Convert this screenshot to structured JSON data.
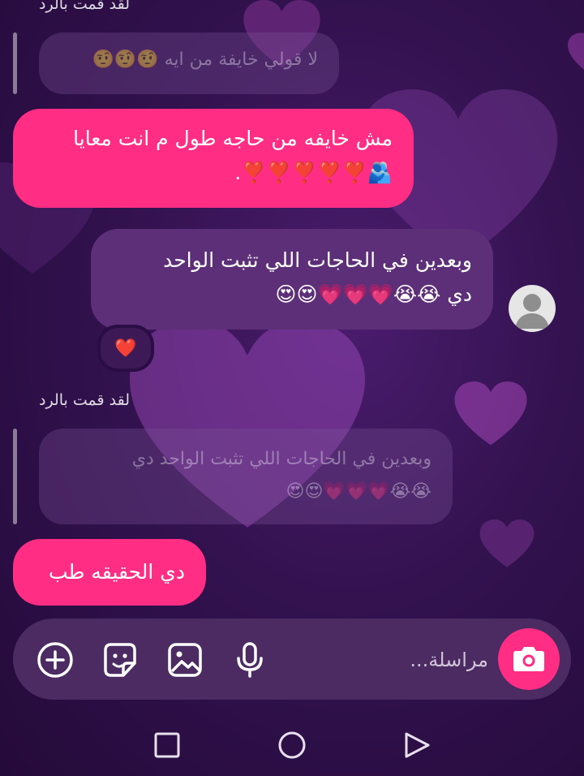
{
  "thread": {
    "reply_label_top": "لقد قمت بالرد",
    "quote_top": {
      "text": "لا قولي خايفة من ايه",
      "emoji": "🤨🤨🤨"
    },
    "sent_1": {
      "line1": "مش خايفه من حاجه طول م انت معايا",
      "line2": "🫂❣️❣️❣️❣️❣️."
    },
    "received_1": {
      "line1": "وبعدين في الحاجات اللي تثبت الواحد",
      "line2": "دي 😭😭💗💗💗😍😍"
    },
    "reaction": "❤️",
    "reply_label_bottom": "لقد قمت بالرد",
    "quote_bottom": {
      "line1": "وبعدين في الحاجات اللي تثبت الواحد دي",
      "line2": "😭😭💗💗💗😍😍"
    },
    "sent_2": "دي الحقيقه طب"
  },
  "composer": {
    "placeholder": "مراسلة...",
    "icons": [
      "plus-icon",
      "sticker-icon",
      "image-icon",
      "mic-icon",
      "camera-icon"
    ]
  },
  "nav": {
    "icons": [
      "recents-icon",
      "home-icon",
      "back-icon"
    ]
  },
  "colors": {
    "accent": "#ff2d83",
    "received_bubble": "#5c2f78",
    "background": "#2a0d45",
    "composer": "#4b2b62"
  }
}
